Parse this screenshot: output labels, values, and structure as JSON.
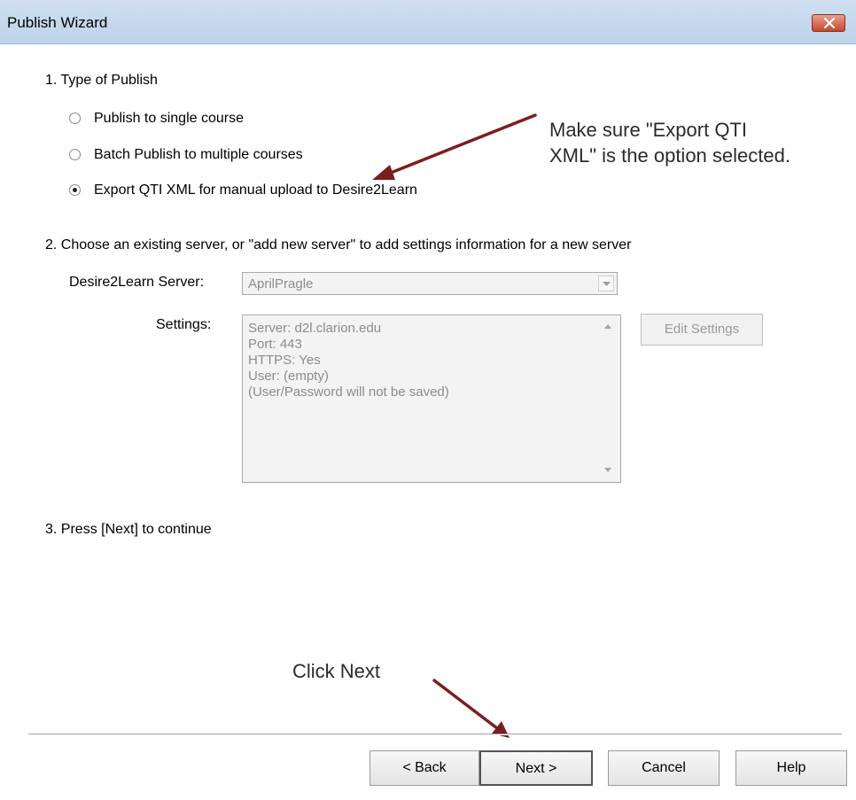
{
  "window": {
    "title": "Publish Wizard"
  },
  "step1": {
    "heading": "1.  Type of Publish",
    "options": [
      {
        "label": "Publish to single course",
        "selected": false
      },
      {
        "label": "Batch Publish to multiple courses",
        "selected": false
      },
      {
        "label": "Export QTI XML for manual upload to Desire2Learn",
        "selected": true
      }
    ]
  },
  "step2": {
    "heading": "2.  Choose an existing server, or \"add new server\" to add settings information for a new server",
    "server_label": "Desire2Learn Server:",
    "server_value": "AprilPragle",
    "settings_label": "Settings:",
    "settings_lines": [
      "Server: d2l.clarion.edu",
      "Port: 443",
      "HTTPS: Yes",
      "User: (empty)",
      "(User/Password will not be saved)"
    ],
    "edit_settings_label": "Edit Settings"
  },
  "step3": {
    "heading": "3.  Press [Next] to continue"
  },
  "annotations": {
    "qti_line1": "Make sure \"Export QTI",
    "qti_line2": "XML\" is the option selected.",
    "click_next": "Click Next",
    "arrow_color": "#7a1f1f"
  },
  "buttons": {
    "back": "< Back",
    "next": "Next >",
    "cancel": "Cancel",
    "help": "Help"
  },
  "icons": {
    "close": "close-icon",
    "dropdown": "chevron-down-icon"
  }
}
